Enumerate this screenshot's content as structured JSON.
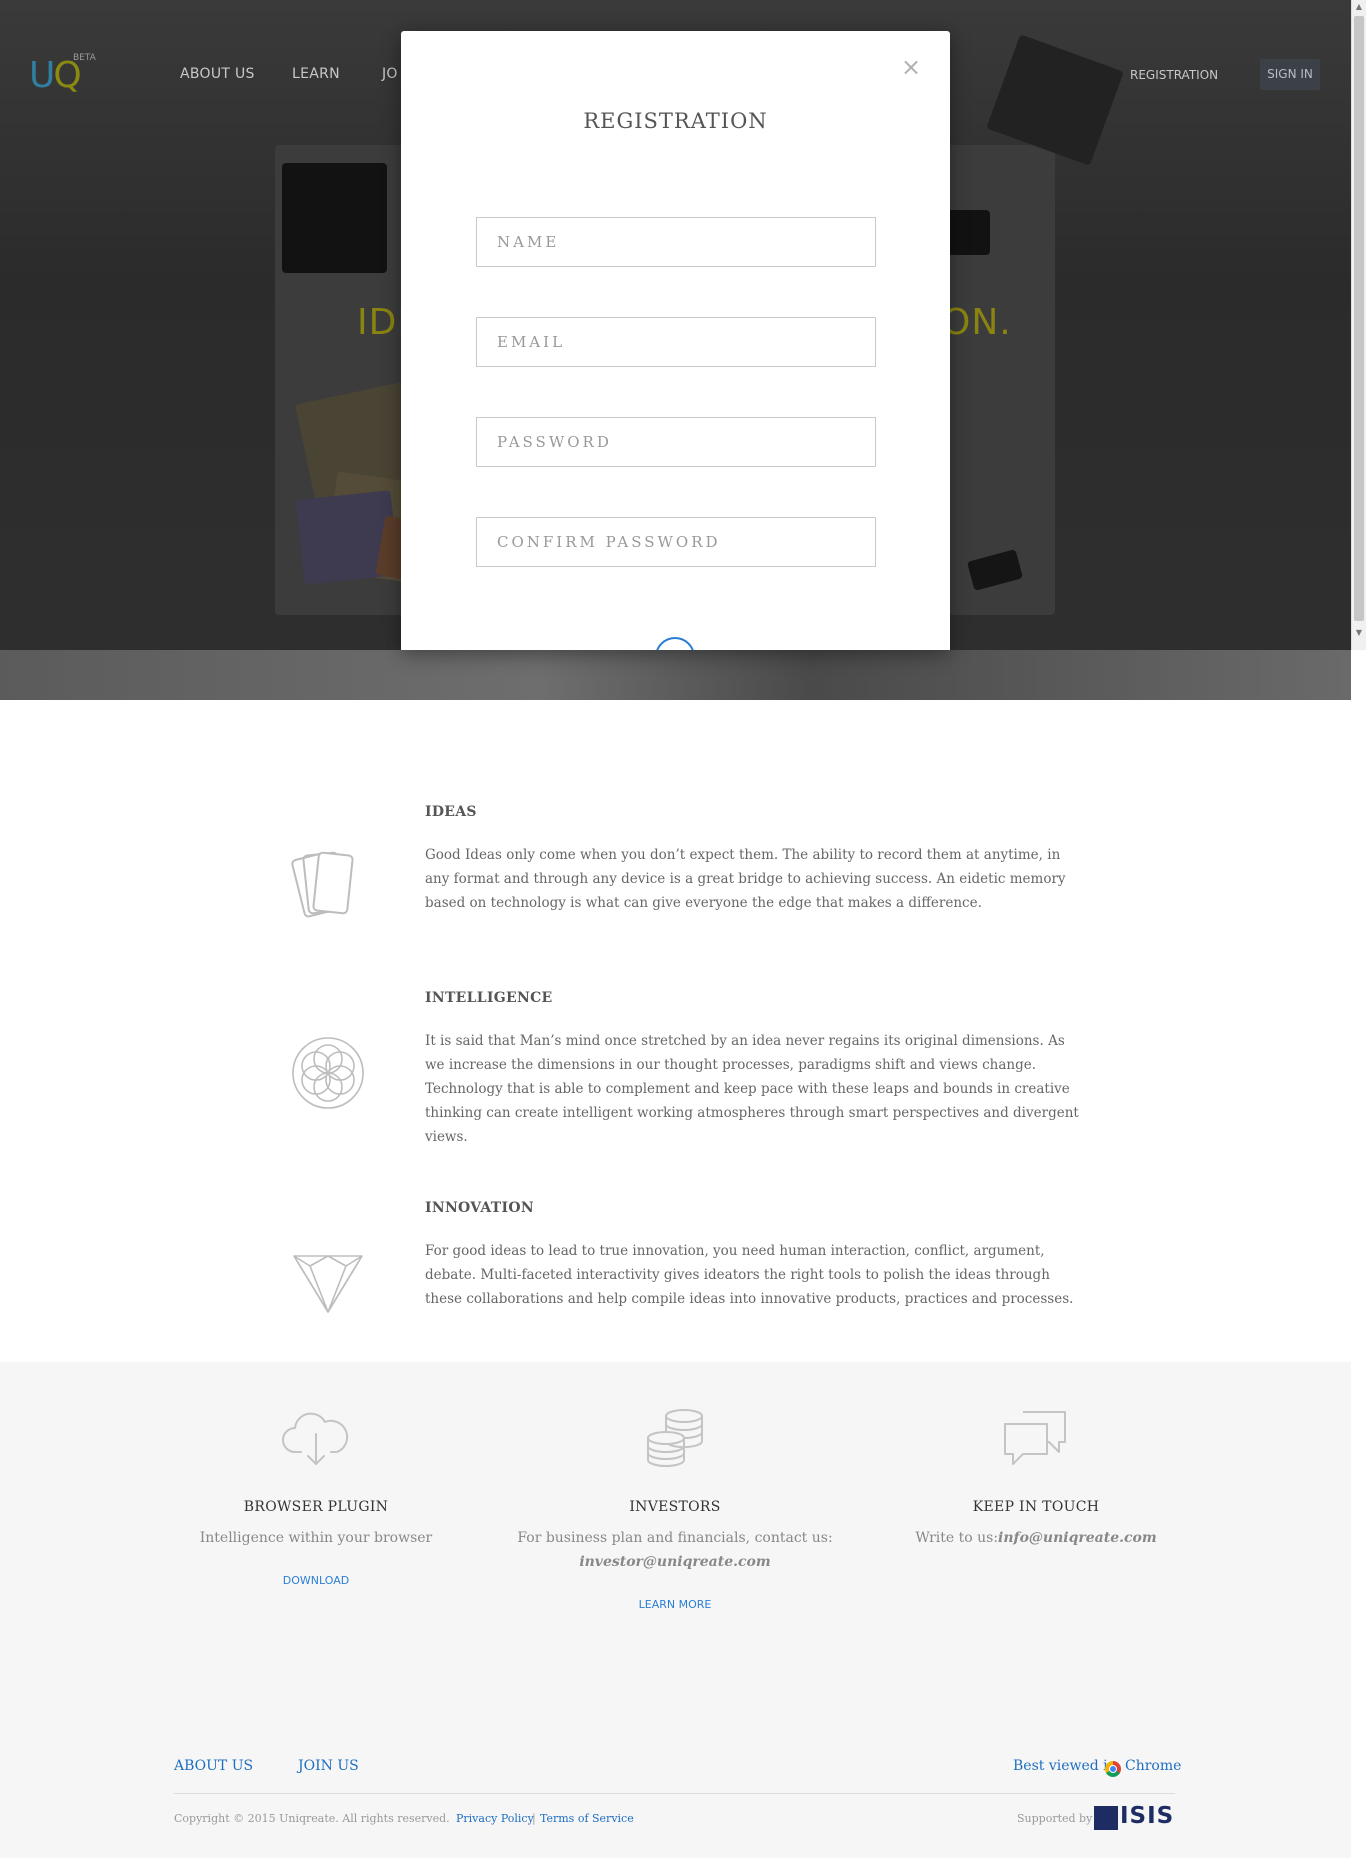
{
  "nav": {
    "logo_u": "U",
    "logo_q": "Q",
    "beta": "BETA",
    "links": [
      "ABOUT US",
      "LEARN",
      "JO"
    ],
    "registration": "REGISTRATION",
    "sign_in": "SIGN IN"
  },
  "hero": {
    "headline_left": "IDE",
    "headline_right": "ON."
  },
  "modal": {
    "close": "×",
    "title": "REGISTRATION",
    "fields": {
      "name_placeholder": "NAME",
      "email_placeholder": "EMAIL",
      "password_placeholder": "PASSWORD",
      "confirm_placeholder": "CONFIRM PASSWORD"
    }
  },
  "features": [
    {
      "icon": "cards-icon",
      "title": "IDEAS",
      "body": "Good Ideas only come when you don’t expect them. The ability to record them at anytime, in any format and through any device is a great bridge to achieving success. An eidetic memory based on technology is what can give everyone the edge that makes a difference."
    },
    {
      "icon": "flower-of-life-icon",
      "title": "INTELLIGENCE",
      "body": "It is said that Man’s mind once stretched by an idea never regains its original dimensions. As we increase the dimensions in our thought processes, paradigms shift and views change. Technology that is able to complement and keep pace with these leaps and bounds in creative thinking can create intelligent working atmospheres through smart perspectives and divergent views."
    },
    {
      "icon": "diamond-icon",
      "title": "INNOVATION",
      "body": "For good ideas to lead to true innovation, you need human interaction, conflict, argument, debate. Multi-faceted interactivity gives ideators the right tools to polish the ideas through these collaborations and help compile ideas into innovative products, practices and processes."
    }
  ],
  "info": {
    "plugin": {
      "icon": "cloud-download-icon",
      "title": "BROWSER PLUGIN",
      "text": "Intelligence within your browser",
      "link": "DOWNLOAD"
    },
    "investors": {
      "icon": "coins-icon",
      "title": "INVESTORS",
      "text": "For business plan and financials, contact us:",
      "email": "investor@uniqreate.com",
      "link": "LEARN MORE"
    },
    "contact": {
      "icon": "chat-bubbles-icon",
      "title": "KEEP IN TOUCH",
      "text": "Write to us:",
      "email": "info@uniqreate.com"
    }
  },
  "footer": {
    "about": "ABOUT US",
    "join": "JOIN US",
    "best_viewed": "Best viewed in",
    "chrome": "Chrome",
    "copyright": "Copyright © 2015 Uniqreate. All rights reserved.",
    "privacy": "Privacy Policy",
    "separator": "|",
    "terms": "Terms of Service",
    "supported_by": "Supported by",
    "isis": "ISIS"
  },
  "colors": {
    "logo_u": "#2f7fa0",
    "logo_q": "#8a8a12",
    "headline": "#8a8410",
    "link_blue": "#1e6ec1",
    "band_bg": "#f6f6f6"
  }
}
